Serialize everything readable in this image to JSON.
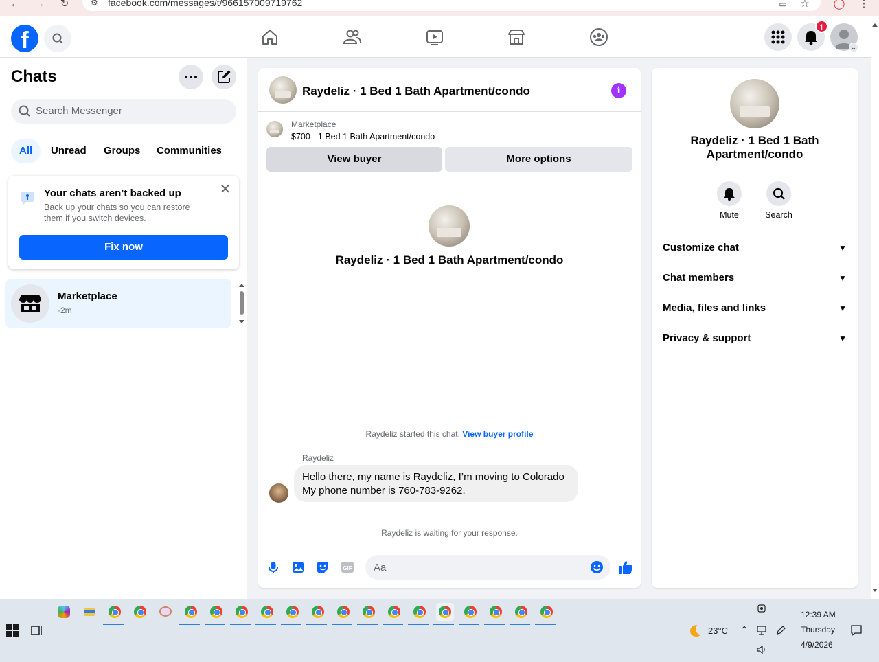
{
  "browser": {
    "url": "facebook.com/messages/t/966157009719762"
  },
  "header": {
    "logo": "f",
    "notification_count": "1"
  },
  "sidebar": {
    "title": "Chats",
    "search_placeholder": "Search Messenger",
    "filters": [
      "All",
      "Unread",
      "Groups",
      "Communities"
    ],
    "backup": {
      "title": "Your chats aren’t backed up",
      "desc": "Back up your chats so you can restore them if you switch devices.",
      "button": "Fix now"
    },
    "chats": [
      {
        "name": "Marketplace",
        "time": "·2m"
      }
    ]
  },
  "chat": {
    "title": "Raydeliz · 1 Bed 1 Bath Apartment/condo",
    "marketplace_label": "Marketplace",
    "listing": "$700 - 1 Bed 1 Bath Apartment/condo",
    "view_buyer": "View buyer",
    "more_options": "More options",
    "center_name": "Raydeliz · 1 Bed 1 Bath Apartment/condo",
    "started_text": "Raydeliz started this chat.",
    "view_buyer_profile": "View buyer profile",
    "sender": "Raydeliz",
    "message_line1": "Hello there, my name is Raydeliz, I’m moving to Colorado",
    "message_line2": "My phone number is 760-783-9262.",
    "waiting": "Raydeliz is waiting for your response.",
    "composer_placeholder": "Aa"
  },
  "info": {
    "name": "Raydeliz · 1 Bed 1 Bath Apartment/condo",
    "mute": "Mute",
    "search": "Search",
    "sections": [
      "Customize chat",
      "Chat members",
      "Media, files and links",
      "Privacy & support"
    ]
  },
  "taskbar": {
    "temperature": "23°C",
    "time": "12:39 AM",
    "day": "Thursday",
    "date": "4/9/2026"
  },
  "colors": {
    "accent": "#0866ff",
    "badge": "#e41e3f",
    "info": "#a033ff"
  }
}
